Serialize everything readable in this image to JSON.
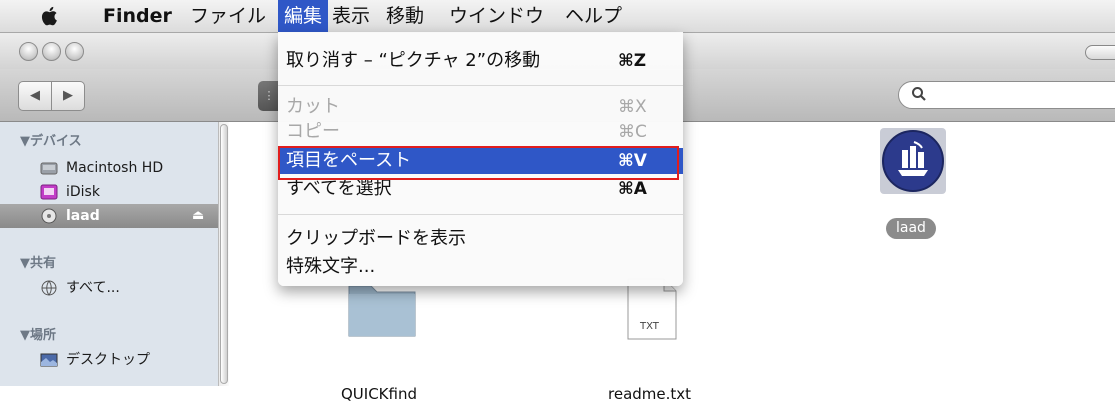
{
  "menubar": {
    "app": "Finder",
    "items": [
      "ファイル",
      "編集",
      "表示",
      "移動",
      "ウインドウ",
      "ヘルプ"
    ]
  },
  "edit_menu": {
    "items": [
      {
        "label": "取り消す – “ピクチャ 2”の移動",
        "shortcut": "⌘Z"
      },
      {
        "label": "カット",
        "shortcut": "⌘X"
      },
      {
        "label": "コピー",
        "shortcut": "⌘C"
      },
      {
        "label": "項目をペースト",
        "shortcut": "⌘V"
      },
      {
        "label": "すべてを選択",
        "shortcut": "⌘A"
      },
      {
        "label": "クリップボードを表示"
      },
      {
        "label": "特殊文字..."
      }
    ]
  },
  "sidebar": {
    "devices_header": "▼デバイス",
    "devices": [
      "Macintosh HD",
      "iDisk",
      "laad"
    ],
    "shared_header": "▼共有",
    "shared": [
      "すべて..."
    ],
    "places_header": "▼場所",
    "places": [
      "デスクトップ"
    ]
  },
  "content": {
    "files": [
      "QUICKfind",
      "readme.txt",
      "laad"
    ],
    "txt_badge": "TXT"
  },
  "colors": {
    "selection": "#2f57c7",
    "highlight_box": "#e11d1d"
  }
}
